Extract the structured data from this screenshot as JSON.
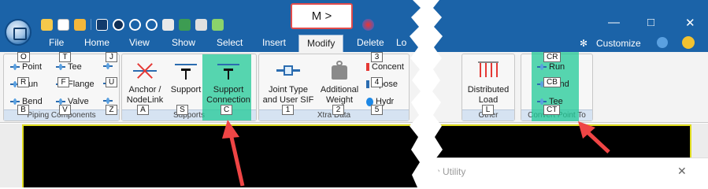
{
  "callout": {
    "text": "M >"
  },
  "menu_tabs": [
    {
      "label": "File"
    },
    {
      "label": "Home"
    },
    {
      "label": "View"
    },
    {
      "label": "Show"
    },
    {
      "label": "Select"
    },
    {
      "label": "Insert"
    },
    {
      "label": "Modify"
    },
    {
      "label": "Delete"
    },
    {
      "label": "Lo"
    }
  ],
  "customize_label": "Customize",
  "groups": {
    "piping": {
      "label": "Piping Components",
      "buttons": [
        {
          "label": "Point",
          "keytip": "O"
        },
        {
          "label": "Tee",
          "keytip": "T"
        },
        {
          "label": "",
          "keytip": "J"
        },
        {
          "label": "Run",
          "keytip": "R"
        },
        {
          "label": "Flange",
          "keytip": "F"
        },
        {
          "label": "",
          "keytip": "U"
        },
        {
          "label": "Bend",
          "keytip": "B"
        },
        {
          "label": "Valve",
          "keytip": "V"
        },
        {
          "label": "",
          "keytip": "Z"
        }
      ]
    },
    "supports": {
      "label": "Supports",
      "buttons": [
        {
          "label": "Anchor / NodeLink",
          "keytip": "A"
        },
        {
          "label": "Support",
          "keytip": "S"
        },
        {
          "label": "Support Connection",
          "keytip": "C"
        }
      ]
    },
    "xtra": {
      "label": "Xtra Data",
      "buttons": [
        {
          "label": "Joint Type and User SIF",
          "keytip": "1"
        },
        {
          "label": "Additional Weight",
          "keytip": "2"
        },
        {
          "label": "Concent",
          "keytip": "3"
        },
        {
          "label": "mpose",
          "keytip": "4"
        },
        {
          "label": "Hydr",
          "keytip": "5"
        }
      ]
    },
    "other": {
      "label": "Other",
      "buttons": [
        {
          "label": "Distributed Load",
          "keytip": "L"
        }
      ]
    },
    "convert": {
      "label": "Convert Point To",
      "buttons": [
        {
          "label": "Run",
          "keytip": "CR"
        },
        {
          "label": "Bend",
          "keytip": "CB"
        },
        {
          "label": "Tee",
          "keytip": "CT"
        }
      ]
    }
  },
  "dialog_title": "n Utility",
  "colors": {
    "title_bar": "#1b63a8",
    "highlight": "#20c997",
    "callout_border": "#e14b4b",
    "arrow": "#ef4545"
  }
}
